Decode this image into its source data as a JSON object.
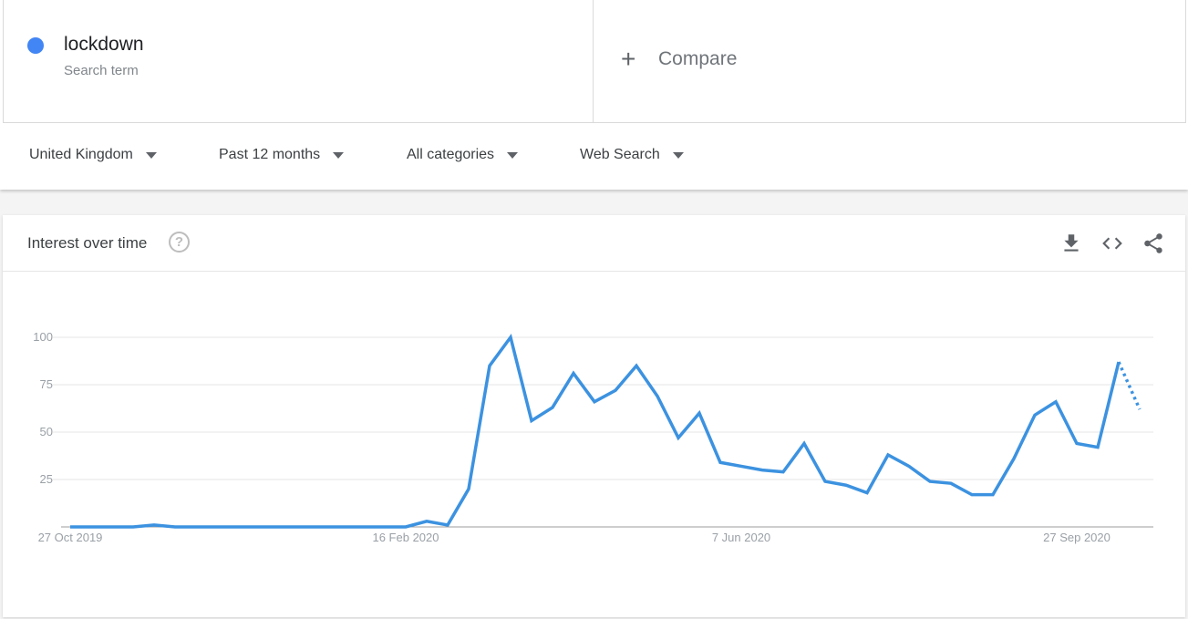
{
  "search_term": {
    "name": "lockdown",
    "subtitle": "Search term",
    "color": "#4285f4"
  },
  "compare": {
    "icon": "plus-icon",
    "plus_glyph": "+",
    "label": "Compare"
  },
  "filters": [
    {
      "label": "United Kingdom"
    },
    {
      "label": "Past 12 months"
    },
    {
      "label": "All categories"
    },
    {
      "label": "Web Search"
    }
  ],
  "card": {
    "title": "Interest over time",
    "help_glyph": "?",
    "tools": [
      "download-icon",
      "embed-code-icon",
      "share-icon"
    ]
  },
  "chart_data": {
    "type": "line",
    "title": "Interest over time",
    "xlabel": "",
    "ylabel": "",
    "ylim": [
      0,
      100
    ],
    "yticks": [
      25,
      50,
      75,
      100
    ],
    "ytick_labels": [
      "25",
      "50",
      "75",
      "100"
    ],
    "xtick_labels": [
      {
        "label": "27 Oct 2019",
        "index": 0
      },
      {
        "label": "16 Feb 2020",
        "index": 16
      },
      {
        "label": "7 Jun 2020",
        "index": 32
      },
      {
        "label": "27 Sep 2020",
        "index": 48
      }
    ],
    "grid": true,
    "line_color": "#3c92e0",
    "series": [
      {
        "name": "lockdown",
        "values": [
          0,
          0,
          0,
          0,
          1,
          0,
          0,
          0,
          0,
          0,
          0,
          0,
          0,
          0,
          0,
          0,
          0,
          3,
          1,
          20,
          85,
          100,
          56,
          63,
          81,
          66,
          72,
          85,
          69,
          47,
          60,
          34,
          32,
          30,
          29,
          44,
          24,
          22,
          18,
          38,
          32,
          24,
          23,
          17,
          17,
          36,
          59,
          66,
          44,
          42,
          87,
          62
        ],
        "partial_last_point": true
      }
    ]
  }
}
